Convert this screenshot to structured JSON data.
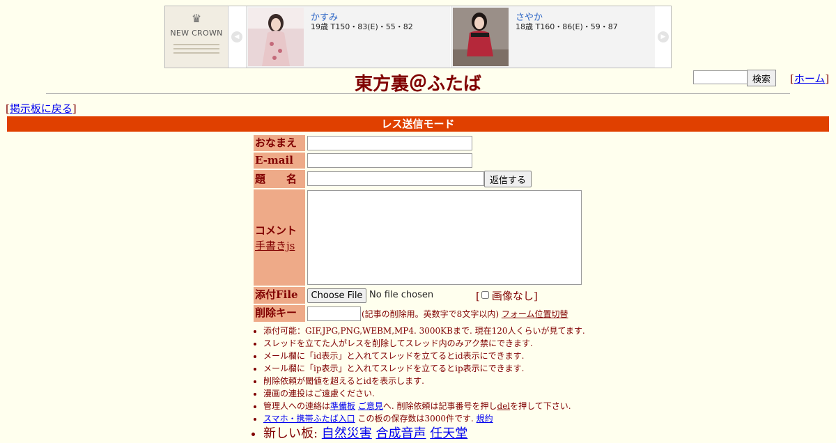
{
  "ad": {
    "logo_crown": "♛",
    "logo_name": "NEW CROWN",
    "prev_icon": "◀",
    "next_icon": "▶",
    "cards": [
      {
        "name": "かすみ",
        "spec": "19歳 T150・83(E)・55・82",
        "photo_bg": "#e9d6d8",
        "dress": "#e8c7c9"
      },
      {
        "name": "さやか",
        "spec": "18歳 T160・86(E)・59・87",
        "photo_bg": "#9a8f88",
        "dress": "#b5283a"
      }
    ]
  },
  "header": {
    "title": "東方裏＠ふたば",
    "search_button": "検索",
    "home_open": "[",
    "home_link": "ホーム",
    "home_close": "]"
  },
  "nav": {
    "back_open": "[",
    "back_link": "掲示板に戻る",
    "back_close": "]"
  },
  "mode_title": "レス送信モード",
  "form": {
    "name_label": "おなまえ",
    "email_label": "E-mail",
    "subject_label": "題　　名",
    "submit_label": "返信する",
    "comment_label": "コメント",
    "handwrite_link": "手書きjs",
    "file_label": "添付File",
    "choose_file": "Choose File",
    "no_file": "No file chosen",
    "noimage_open": "[",
    "noimage_label": "画像なし",
    "noimage_close": "]",
    "delkey_label": "削除キー",
    "delkey_note": "(記事の削除用。英数字で8文字以内)",
    "form_switch": "フォーム位置切替"
  },
  "rules": {
    "r1": "添付可能：GIF,JPG,PNG,WEBM,MP4. 3000KBまで. 現在120人くらいが見てます.",
    "r2": "スレッドを立てた人がレスを削除してスレッド内のみアク禁にできます.",
    "r3": "メール欄に「id表示」と入れてスレッドを立てるとid表示にできます.",
    "r4": "メール欄に「ip表示」と入れてスレッドを立てるとip表示にできます.",
    "r5": "削除依頼が閾値を超えるとidを表示します.",
    "r6": "漫画の連投はご遠慮ください.",
    "r7_pre": "管理人への連絡は",
    "r7_link1": "準備板",
    "r7_sep": " ",
    "r7_link2": "ご意見",
    "r7_mid": "へ. 削除依頼は記事番号を押し",
    "r7_del": "del",
    "r7_post": "を押して下さい.",
    "r8_link": "スマホ・携帯ふたば入口",
    "r8_mid": " この板の保存数は3000件です. ",
    "r8_link2": "規約",
    "r9_pre": "新しい板: ",
    "r9_links": [
      "自然災害",
      "合成音声",
      "任天堂"
    ]
  }
}
